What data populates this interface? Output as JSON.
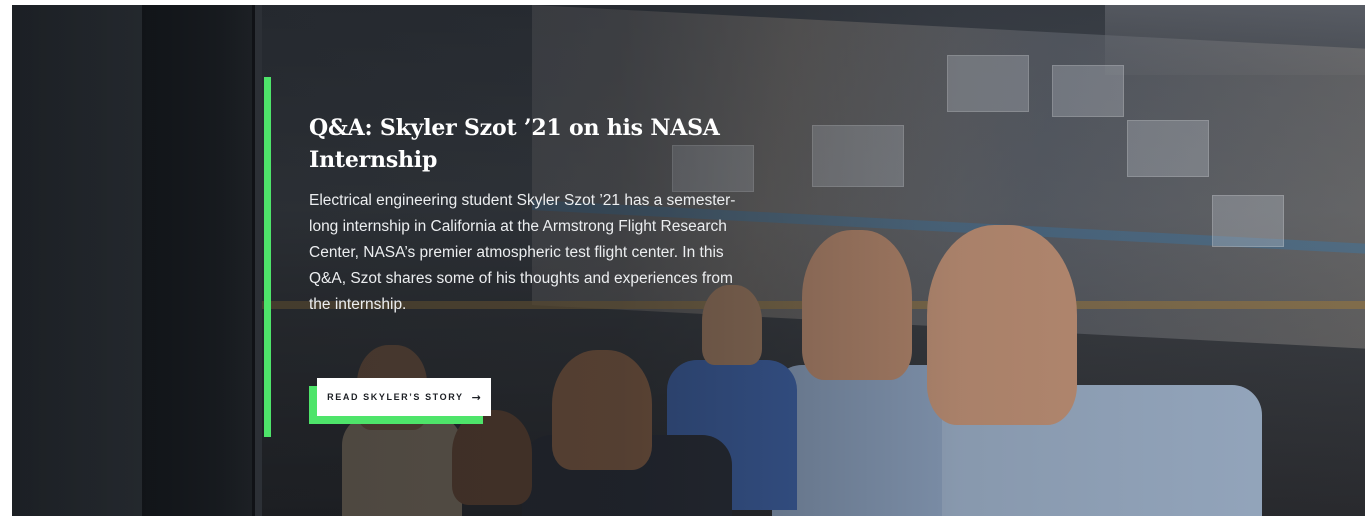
{
  "hero": {
    "title": "Q&A: Skyler Szot ’21 on his NASA Internship",
    "description": "Electrical engineering student Skyler Szot ’21 has a semester-long internship in California at the Armstrong Flight Research Center, NASA’s premier atmospheric test flight center. In this Q&A, Szot shares some of his thoughts and experiences from the internship.",
    "cta_label": "READ SKYLER’S STORY",
    "cta_icon": "arrow-right-icon",
    "accent_color": "#4ee46a"
  }
}
